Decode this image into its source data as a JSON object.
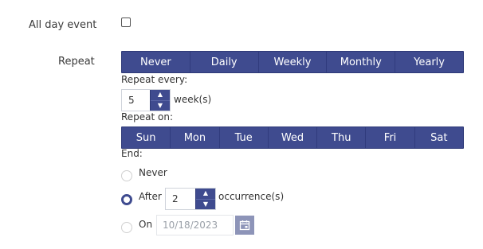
{
  "all_day": {
    "label": "All day event",
    "checked": false
  },
  "repeat": {
    "label": "Repeat",
    "options": [
      "Never",
      "Daily",
      "Weekly",
      "Monthly",
      "Yearly"
    ],
    "selected": "Weekly"
  },
  "repeat_every": {
    "label": "Repeat every:",
    "value": "5",
    "unit": "week(s)"
  },
  "repeat_on": {
    "label": "Repeat on:",
    "days": [
      "Sun",
      "Mon",
      "Tue",
      "Wed",
      "Thu",
      "Fri",
      "Sat"
    ]
  },
  "end": {
    "label": "End:",
    "never_label": "Never",
    "after_label": "After",
    "after_value": "2",
    "after_unit": "occurrence(s)",
    "on_label": "On",
    "on_date": "10/18/2023",
    "selected": "After"
  },
  "colors": {
    "accent": "#3f4b8f",
    "calendar_button": "#8d94b8"
  },
  "icons": {
    "spin_up": "chevron-up-icon",
    "spin_down": "chevron-down-icon",
    "calendar": "calendar-icon"
  }
}
